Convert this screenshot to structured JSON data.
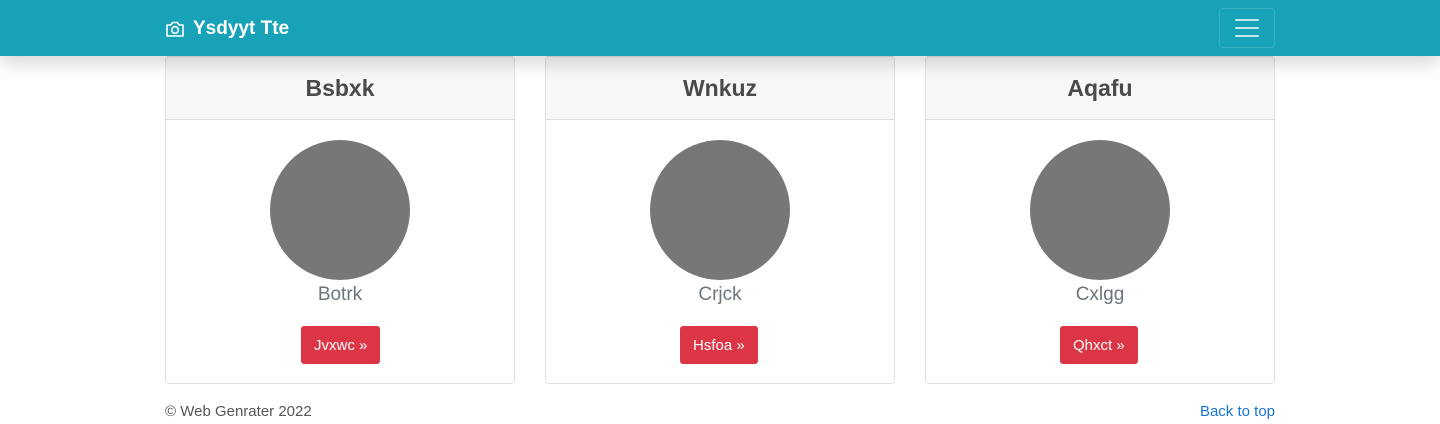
{
  "navbar": {
    "brand_icon": "camera-icon",
    "brand_label": "Ysdyyt Tte",
    "toggler_icon": "hamburger-menu-icon",
    "background": "#17a2b8"
  },
  "cards": [
    {
      "title": "Bsbxk",
      "subtitle": "Botrk",
      "button_label": "Jvxwc »"
    },
    {
      "title": "Wnkuz",
      "subtitle": "Crjck",
      "button_label": "Hsfoa »"
    },
    {
      "title": "Aqafu",
      "subtitle": "Cxlgg",
      "button_label": "Qhxct »"
    }
  ],
  "colors": {
    "button": "#dc3545",
    "avatar": "#777777",
    "link": "#1a73d9"
  },
  "footer": {
    "copyright": "© Web Genrater 2022",
    "back_to_top": "Back to top"
  }
}
